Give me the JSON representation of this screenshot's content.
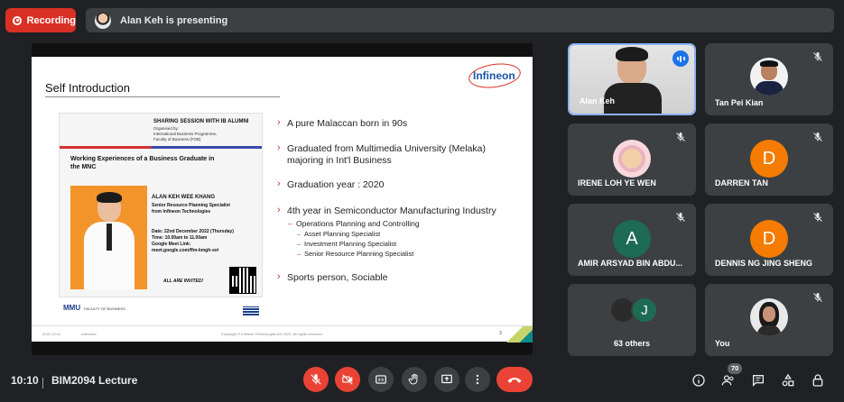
{
  "top": {
    "recording_label": "Recording",
    "presenting_text": "Alan Keh is presenting"
  },
  "slide": {
    "title": "Self Introduction",
    "logo_text": "Infineon",
    "poster": {
      "heading": "SHARING SESSION WITH IB ALUMNI",
      "organised": "Organised by:",
      "org_line1": "International Business Programme,",
      "org_line2": "Faculty of Business (FOB)",
      "subtitle": "Working Experiences of a Business Graduate in the MNC",
      "name": "ALAN KEH WEE KHANG",
      "role_line1": "Senior Resource Planning Specialist",
      "role_line2": "from Infineon Technologies",
      "date": "Date: 22nd December 2022 (Thursday)",
      "time": "Time: 10.00am to 11.00am",
      "meet_label": "Google Meet Link:",
      "meet_link": "meet.google.com/ffm-kmgh-svt",
      "invited": "ALL ARE INVITED!",
      "mmu_logo": "MMU",
      "faculty_logo": "FACULTY OF BUSINESS"
    },
    "bullets": {
      "b1": "A pure Malaccan born in 90s",
      "b2_line1": "Graduated from Multimedia University (Melaka)",
      "b2_line2": "majoring in Int'l Business",
      "b3": "Graduation year : 2020",
      "b4": "4th year in Semiconductor Manufacturing Industry",
      "b4_sub": "Operations Planning and Controlling",
      "b4_subsub1": "Asset Planning Specialist",
      "b4_subsub2": "Investment Planning Specialist",
      "b4_subsub3": "Senior Resource Planning Specialist",
      "b5": "Sports person, Sociable"
    },
    "footer": {
      "date": "2022-12-xx",
      "restricted": "restricted",
      "copyright": "Copyright © Infineon Technologies AG 2022. All rights reserved.",
      "page": "3"
    }
  },
  "participants": [
    {
      "name": "Alan Keh"
    },
    {
      "name": "Tan Pei Kian"
    },
    {
      "name": "IRENE LOH YE WEN"
    },
    {
      "name": "DARREN TAN",
      "initial": "D"
    },
    {
      "name": "AMIR ARSYAD BIN ABDU...",
      "initial": "A"
    },
    {
      "name": "DENNIS NG JING SHENG",
      "initial": "D"
    },
    {
      "name": "63 others",
      "initial": "J"
    },
    {
      "name": "You"
    }
  ],
  "bottom": {
    "time": "10:10",
    "meeting": "BIM2094 Lecture",
    "people_count": "70"
  },
  "colors": {
    "recording_red": "#d93025",
    "orange_avatar": "#f57c00",
    "teal_avatar": "#1e6b54",
    "active_blue": "#8ab4f8"
  }
}
